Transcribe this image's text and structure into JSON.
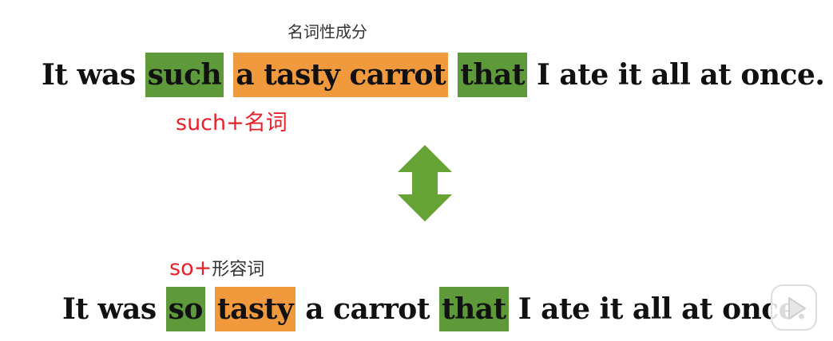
{
  "top_label": "名词性成分",
  "sentence1": {
    "part1": "It was ",
    "such": "such",
    "noun_phrase": "a tasty carrot",
    "that": "that",
    "part2": " I ate it all at once."
  },
  "label_such": "such+名词",
  "arrow": {
    "icon": "double-arrow-vertical-icon",
    "color": "#66a435"
  },
  "label_so": {
    "so": "so+",
    "adj": "形容词"
  },
  "sentence2": {
    "part1": "It was ",
    "so": "so",
    "tasty": "tasty",
    "middle": " a carrot ",
    "that": "that",
    "part2": " I ate it all at once."
  },
  "colors": {
    "green_highlight": "#5e9a3a",
    "orange_highlight": "#f0993d",
    "red_text": "#e8212a"
  },
  "player_icon": "play-icon"
}
